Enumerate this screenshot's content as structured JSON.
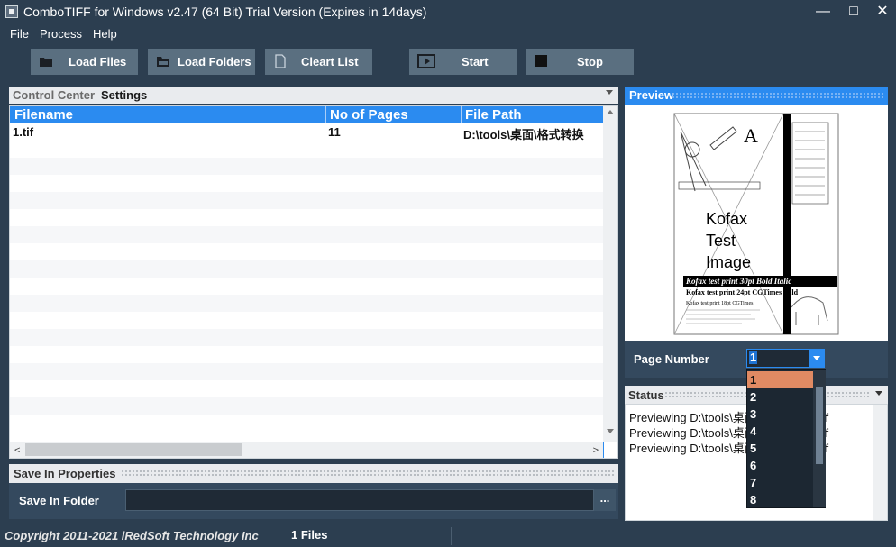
{
  "window": {
    "title": "ComboTIFF for Windows v2.47 (64 Bit)  Trial Version (Expires in 14days)",
    "minimize": "—",
    "maximize": "□",
    "close": "✕"
  },
  "menu": [
    "File",
    "Process",
    "Help"
  ],
  "toolbar": {
    "load_files": "Load Files",
    "load_folders": "Load Folders",
    "clear_list": "Cleart List",
    "start": "Start",
    "stop": "Stop"
  },
  "tabs": {
    "control_center": "Control Center",
    "settings": "Settings"
  },
  "grid": {
    "columns": [
      "Filename",
      "No of Pages",
      "File Path"
    ],
    "rows": [
      {
        "filename": "1.tif",
        "pages": "11",
        "path": "D:\\tools\\桌面\\格式转换"
      }
    ]
  },
  "save_props": {
    "title": "Save In Properties",
    "folder_label": "Save In Folder",
    "folder_value": "",
    "browse": "..."
  },
  "preview": {
    "title": "Preview",
    "image_text": {
      "letter": "A",
      "line1": "Kofax",
      "line2": "Test",
      "line3": "Image",
      "print1": "Kofax test print 30pt Bold Italic",
      "print2": "Kofax test print 24pt CGTimes Bold",
      "print3": "Kofax test print 18pt CGTimes"
    }
  },
  "page_number": {
    "label": "Page Number",
    "value": "1",
    "options": [
      "1",
      "2",
      "3",
      "4",
      "5",
      "6",
      "7",
      "8"
    ]
  },
  "status": {
    "title": "Status",
    "lines": [
      "Previewing D:\\tools\\桌面\\格式转换\\1.tif",
      "Previewing D:\\tools\\桌面\\格式转换\\1.tif",
      "Previewing D:\\tools\\桌面\\格式转换\\1.tif"
    ]
  },
  "footer": {
    "copyright": "Copyright 2011-2021 iRedSoft Technology Inc",
    "files": "1 Files"
  },
  "colors": {
    "header_blue": "#2b8bf0",
    "dark_bg": "#2c3e50",
    "button_bg": "#5a6f80",
    "selected": "#e08a63"
  }
}
